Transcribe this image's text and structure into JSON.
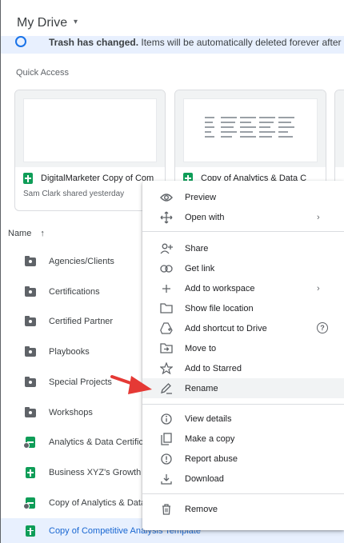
{
  "header": {
    "title": "My Drive",
    "caret": "▾"
  },
  "banner": {
    "bold": "Trash has changed.",
    "text": " Items will be automatically deleted forever after thirty days"
  },
  "quick_access": {
    "heading": "Quick Access",
    "cards": [
      {
        "name": "DigitalMarketer Copy of Com",
        "sub": "Sam Clark shared yesterday"
      },
      {
        "name": "Copy of Analytics & Data C",
        "sub": ""
      }
    ]
  },
  "list": {
    "header": "Name",
    "sort_arrow": "↑",
    "rows": [
      {
        "label": "Agencies/Clients",
        "type": "folder"
      },
      {
        "label": "Certifications",
        "type": "folder"
      },
      {
        "label": "Certified Partner",
        "type": "folder"
      },
      {
        "label": "Playbooks",
        "type": "folder"
      },
      {
        "label": "Special Projects",
        "type": "folder"
      },
      {
        "label": "Workshops",
        "type": "folder"
      },
      {
        "label": "Analytics & Data Certificat",
        "type": "sheet-shared"
      },
      {
        "label": "Business XYZ's Growth Sc",
        "type": "sheet"
      },
      {
        "label": "Copy of Analytics & Data C",
        "type": "sheet-shared"
      },
      {
        "label": "Copy of Competitive Analysis Template",
        "type": "sheet",
        "selected": true
      }
    ]
  },
  "context_menu": {
    "items": [
      {
        "label": "Preview",
        "icon": "eye-icon"
      },
      {
        "label": "Open with",
        "icon": "move-icon",
        "arrow": "›"
      },
      {
        "label": "Share",
        "icon": "person-add-icon"
      },
      {
        "label": "Get link",
        "icon": "link-icon"
      },
      {
        "label": "Add to workspace",
        "icon": "plus-icon",
        "arrow": "›"
      },
      {
        "label": "Show file location",
        "icon": "folder-outline-icon"
      },
      {
        "label": "Add shortcut to Drive",
        "icon": "drive-shortcut-icon",
        "help": "?"
      },
      {
        "label": "Move to",
        "icon": "move-to-icon"
      },
      {
        "label": "Add to Starred",
        "icon": "star-icon"
      },
      {
        "label": "Rename",
        "icon": "pencil-icon",
        "hover": true
      },
      {
        "label": "View details",
        "icon": "info-icon"
      },
      {
        "label": "Make a copy",
        "icon": "copy-icon"
      },
      {
        "label": "Report abuse",
        "icon": "alert-icon"
      },
      {
        "label": "Download",
        "icon": "download-icon"
      },
      {
        "label": "Remove",
        "icon": "trash-icon"
      }
    ]
  },
  "colors": {
    "accent": "#1a73e8",
    "selected_bg": "#e8f0fe",
    "sheets_green": "#0f9d58",
    "annotation_arrow": "#e53935"
  }
}
